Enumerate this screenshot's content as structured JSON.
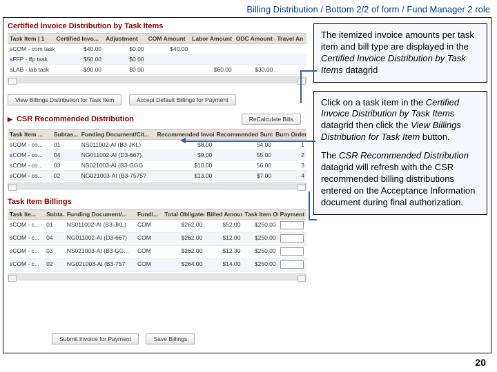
{
  "slide_title": "Billing Distribution / Bottom 2/2 of form / Fund Manager 2 role",
  "page_number": "20",
  "callouts": {
    "c1": "The itemized invoice amounts per task item and bill type are displayed in the ",
    "c1_it1": "Certified Invoice Distribution by Task Items",
    "c1_end": " datagrid",
    "c2a": "Click on a task item in the ",
    "c2_it1": "Certified Invoice Distribution by Task Items",
    "c2b": " datagrid then click the ",
    "c2_it2": "View Billings Distribution for Task Item",
    "c2c": " button.",
    "c2_p2a": "The ",
    "c2_it3": "CSR Recommended Distribution",
    "c2_p2b": " datagrid will refresh with the CSR recommended billing distributions entered on the Acceptance Information document during final authorization."
  },
  "screenshot": {
    "sec1_title": "Certified Invoice Distribution by Task Items",
    "sec2_title": "CSR Recommended Distribution",
    "sec3_title": "Task Item Billings",
    "btn_view": "View Billings Distribution for Task Item",
    "btn_accept": "Accept Default Billings for Payment",
    "btn_recalc": "ReCalculate Bills",
    "btn_submit": "Submit Invoice for Payment",
    "btn_save": "Save Billings",
    "g1": {
      "headers": [
        "Task Item | 1",
        "Certified Invo...",
        "Adjustment",
        "COM Amount",
        "Labor Amount",
        "ODC Amount",
        "Travel An"
      ],
      "rows": [
        [
          "sCOM - com task",
          "$40.00",
          "$0.00",
          "$40.00",
          "",
          "",
          ""
        ],
        [
          "sFFP - ffp task",
          "$50.00",
          "$0.00",
          "",
          "",
          "",
          ""
        ],
        [
          "sLAB - lab task",
          "$90.00",
          "$0.00",
          "",
          "$60.00",
          "$30.00",
          ""
        ]
      ]
    },
    "g2": {
      "headers": [
        "Task Item ...",
        "Subtas...",
        "Funding Document/Cit...",
        "Recommended Invoi...",
        "Recommended Surc...",
        "Burn Order"
      ],
      "rows": [
        [
          "sCOM - co...",
          "01",
          "NS011002-AI (B3-JKL)",
          "$8.00",
          "54.00",
          "1"
        ],
        [
          "sCOM - co...",
          "04",
          "NG011002-AI (D3-667)",
          "$9.00",
          "55.00",
          "2"
        ],
        [
          "sCOM - co...",
          "03",
          "NS021003-AI (B3-GGG",
          "$10.00",
          "56.00",
          "3"
        ],
        [
          "sCOM - co...",
          "02",
          "NG021003-AI (B3-7575?",
          "$13.00",
          "$7.00",
          "4"
        ]
      ]
    },
    "g3": {
      "headers": [
        "Task Ite...",
        "Subta...",
        "Funding Document/...",
        "Fundi...",
        "Total Obligated",
        "Billed Amount",
        "Task Item Ob...",
        "Payment Ai"
      ],
      "rows": [
        [
          "sCOM - c...",
          "01",
          "NS011002-AI (B3-JKL)",
          "COM",
          "$262.00",
          "$52.00",
          "$250.00",
          ""
        ],
        [
          "sCOM - c...",
          "04",
          "NG011002-AI (D3-667)",
          "COM",
          "$262.00",
          "$12.00",
          "$250.00",
          ""
        ],
        [
          "sCOM - c...",
          "03",
          "NS021003-AI (B3-GG...",
          "COM",
          "$262.00",
          "$12.30",
          "$250.00",
          ""
        ],
        [
          "sCOM - c...",
          "02",
          "NG021003-AI (B3-757",
          "COM",
          "$264.00",
          "$14.00",
          "$250.00",
          ""
        ]
      ]
    }
  }
}
